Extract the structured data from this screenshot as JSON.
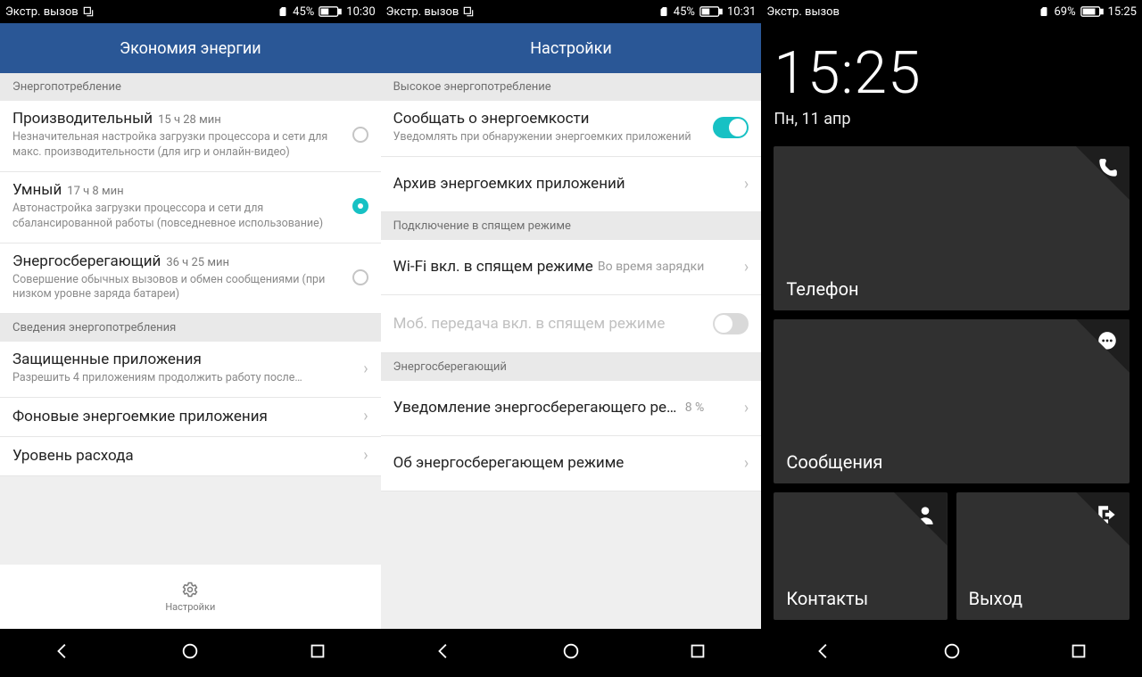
{
  "p1": {
    "status": {
      "carrier": "Экстр. вызов",
      "battery": "45%",
      "time": "10:30"
    },
    "header": "Экономия энергии",
    "s1_head": "Энергопотребление",
    "modes": [
      {
        "title": "Производительный",
        "time": "15 ч 28 мин",
        "sub": "Незначительная настройка загрузки процессора и сети для макс. производительности (для игр и онлайн-видео)",
        "selected": false
      },
      {
        "title": "Умный",
        "time": "17 ч 8 мин",
        "sub": "Автонастройка загрузки процессора и сети для сбалансированной работы (повседневное использование)",
        "selected": true
      },
      {
        "title": "Энергосберегающий",
        "time": "36 ч 25 мин",
        "sub": "Совершение обычных вызовов и обмен сообщениями (при низком уровне заряда батареи)",
        "selected": false
      }
    ],
    "s2_head": "Сведения энергопотребления",
    "items": [
      {
        "title": "Защищенные приложения",
        "sub": "Разрешить 4 приложениям продолжить работу после…"
      },
      {
        "title": "Фоновые энергоемкие приложения"
      },
      {
        "title": "Уровень расхода"
      }
    ],
    "bottom_label": "Настройки"
  },
  "p2": {
    "status": {
      "carrier": "Экстр. вызов",
      "battery": "45%",
      "time": "10:31"
    },
    "header": "Настройки",
    "s1_head": "Высокое энергопотребление",
    "notify": {
      "title": "Сообщать о энергоемкости",
      "sub": "Уведомлять при обнаружении энергоемких приложений",
      "on": true
    },
    "archive": "Архив энергоемких приложений",
    "s2_head": "Подключение в спящем режиме",
    "wifi": {
      "title": "Wi-Fi вкл. в спящем режиме",
      "value": "Во время зарядки"
    },
    "mobile": {
      "title": "Моб. передача вкл. в спящем режиме",
      "on": false
    },
    "s3_head": "Энергосберегающий",
    "notif2": {
      "title": "Уведомление энергосберегающего ре…",
      "value": "8 %"
    },
    "about": "Об энергосберегающем режиме"
  },
  "p3": {
    "status": {
      "carrier": "Экстр. вызов",
      "battery": "69%",
      "time": "15:25"
    },
    "clock": "15:25",
    "date": "Пн, 11 апр",
    "tiles": {
      "phone": "Телефон",
      "messages": "Сообщения",
      "contacts": "Контакты",
      "exit": "Выход"
    }
  }
}
